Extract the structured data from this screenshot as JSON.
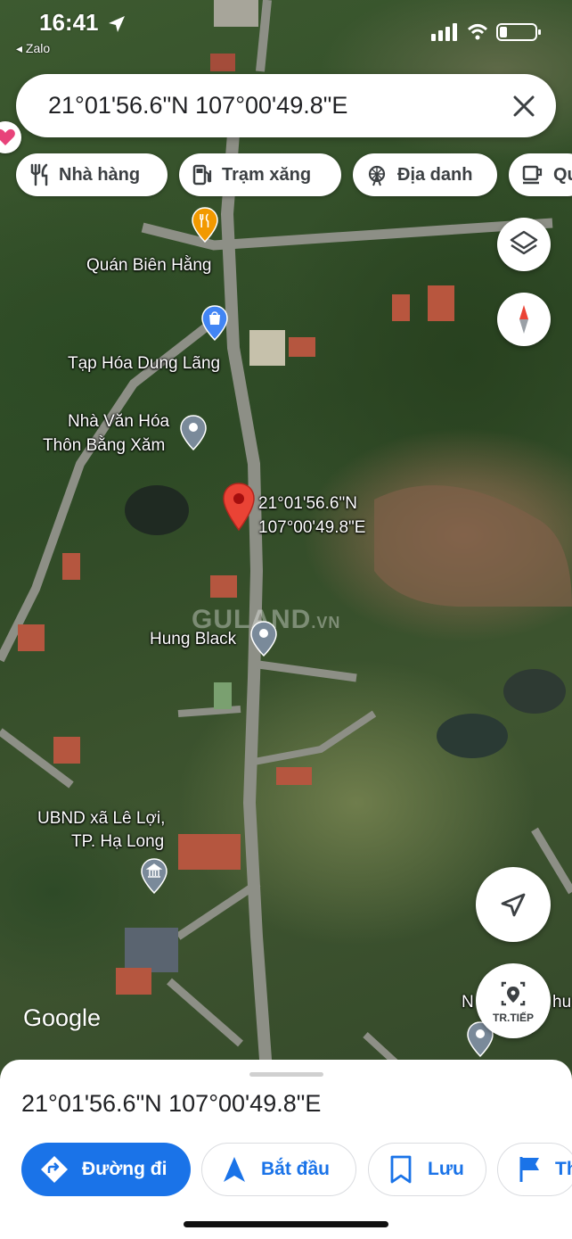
{
  "status_bar": {
    "time": "16:41",
    "back_app": "◂ Zalo"
  },
  "search": {
    "query": "21°01'56.6\"N 107°00'49.8\"E"
  },
  "chips": [
    {
      "label": "Nhà hàng",
      "icon": "fork-knife-icon"
    },
    {
      "label": "Trạm xăng",
      "icon": "gas-station-icon"
    },
    {
      "label": "Địa danh",
      "icon": "ferris-wheel-icon"
    },
    {
      "label": "Qu",
      "icon": "coffee-cup-icon"
    }
  ],
  "map": {
    "labels": {
      "quan_bien_hang": "Quán Biên Hằng",
      "tap_hoa": "Tạp Hóa Dung Lãng",
      "nha_van_hoa_1": "Nhà Văn Hóa",
      "nha_van_hoa_2": "Thôn Bằng Xăm",
      "pin_coord_1": "21°01'56.6\"N",
      "pin_coord_2": "107°00'49.8\"E",
      "hung_black": "Hung Black",
      "ubnd_1": "UBND xã Lê Lợi,",
      "ubnd_2": "TP. Hạ Long",
      "partial_right_1": "N",
      "partial_right_2": "hu"
    },
    "watermark": "GULAND",
    "watermark_suffix": ".VN",
    "attribution": "Google",
    "pin_color": "#ea4335"
  },
  "controls": {
    "start_nav_label": "TR.TIẾP"
  },
  "sheet": {
    "title": "21°01'56.6\"N 107°00'49.8\"E",
    "actions": [
      {
        "label": "Đường đi",
        "icon": "directions-icon"
      },
      {
        "label": "Bắt đầu",
        "icon": "navigation-arrow-icon"
      },
      {
        "label": "Lưu",
        "icon": "bookmark-icon"
      },
      {
        "label": "Th",
        "icon": "flag-icon"
      }
    ]
  },
  "colors": {
    "accent": "#1a73e8",
    "pin": "#ea4335"
  }
}
